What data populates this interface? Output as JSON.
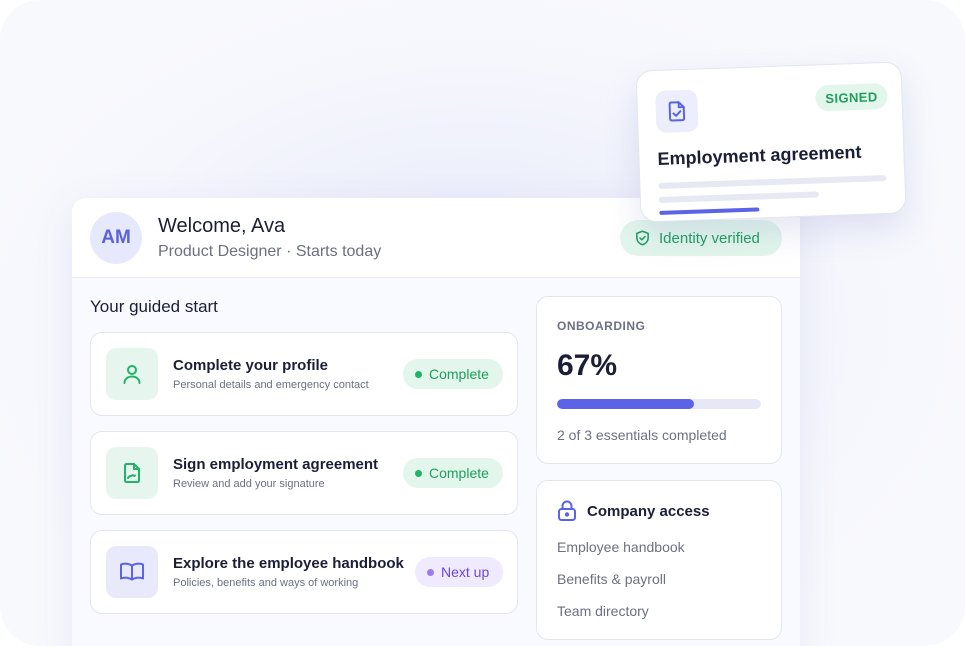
{
  "header": {
    "avatar_initials": "AM",
    "title": "Welcome, Ava",
    "subtitle": "Product Designer · Starts today",
    "verified_label": "Identity verified"
  },
  "guided_start": {
    "title": "Your guided start",
    "tasks": [
      {
        "title": "Complete your profile",
        "desc": "Personal details and emergency contact",
        "status": "Complete",
        "icon": "user-icon"
      },
      {
        "title": "Sign employment agreement",
        "desc": "Review and add your signature",
        "status": "Complete",
        "icon": "signature-icon"
      },
      {
        "title": "Explore the employee handbook",
        "desc": "Policies, benefits and ways of working",
        "status": "Next up",
        "icon": "book-icon"
      }
    ]
  },
  "onboarding": {
    "label": "ONBOARDING",
    "percent_label": "67%",
    "progress": 0.67,
    "note": "2 of 3 essentials completed"
  },
  "company_access": {
    "title": "Company access",
    "items": [
      "Employee handbook",
      "Benefits & payroll",
      "Team directory"
    ]
  },
  "agreement_card": {
    "badge": "SIGNED",
    "title": "Employment agreement"
  },
  "colors": {
    "accent": "#5b63e6",
    "success": "#1f9e5c",
    "success_bg": "#e3f6ec",
    "next_bg": "#efeafd",
    "next_text": "#6c47d8"
  }
}
